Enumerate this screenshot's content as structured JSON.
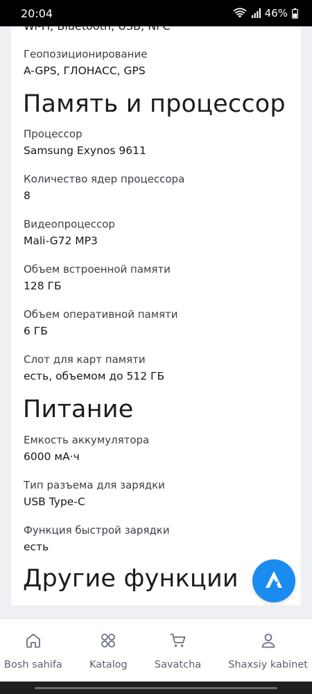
{
  "status_bar": {
    "time": "20:04",
    "battery": "46%"
  },
  "specs": {
    "cut_top_text": "Wi-Fi, Bluetooth, USB, NFC",
    "geo_label": "Геопозиционирование",
    "geo_value": "A-GPS, ГЛОНАСС, GPS",
    "section_memory": "Память и процессор",
    "cpu_label": "Процессор",
    "cpu_value": "Samsung Exynos 9611",
    "cores_label": "Количество ядер процессора",
    "cores_value": "8",
    "gpu_label": "Видеопроцессор",
    "gpu_value": "Mali-G72 MP3",
    "storage_label": "Объем встроенной памяти",
    "storage_value": "128 ГБ",
    "ram_label": "Объем оперативной памяти",
    "ram_value": "6 ГБ",
    "slot_label": "Слот для карт памяти",
    "slot_value": "есть, объемом до 512 ГБ",
    "section_power": "Питание",
    "battery_label": "Емкость аккумулятора",
    "battery_value": "6000 мА·ч",
    "connector_label": "Тип разъема для зарядки",
    "connector_value": "USB Type-C",
    "fastcharge_label": "Функция быстрой зарядки",
    "fastcharge_value": "есть",
    "section_other": "Другие функции"
  },
  "fab": {
    "icon": "brand-logo-icon"
  },
  "nav": [
    {
      "label": "Bosh sahifa",
      "icon": "home-icon"
    },
    {
      "label": "Katalog",
      "icon": "grid-icon"
    },
    {
      "label": "Savatcha",
      "icon": "cart-icon"
    },
    {
      "label": "Shaxsiy kabinet",
      "icon": "user-icon"
    }
  ],
  "colors": {
    "accent": "#1a8cf0",
    "nav_text": "#5b6070"
  }
}
